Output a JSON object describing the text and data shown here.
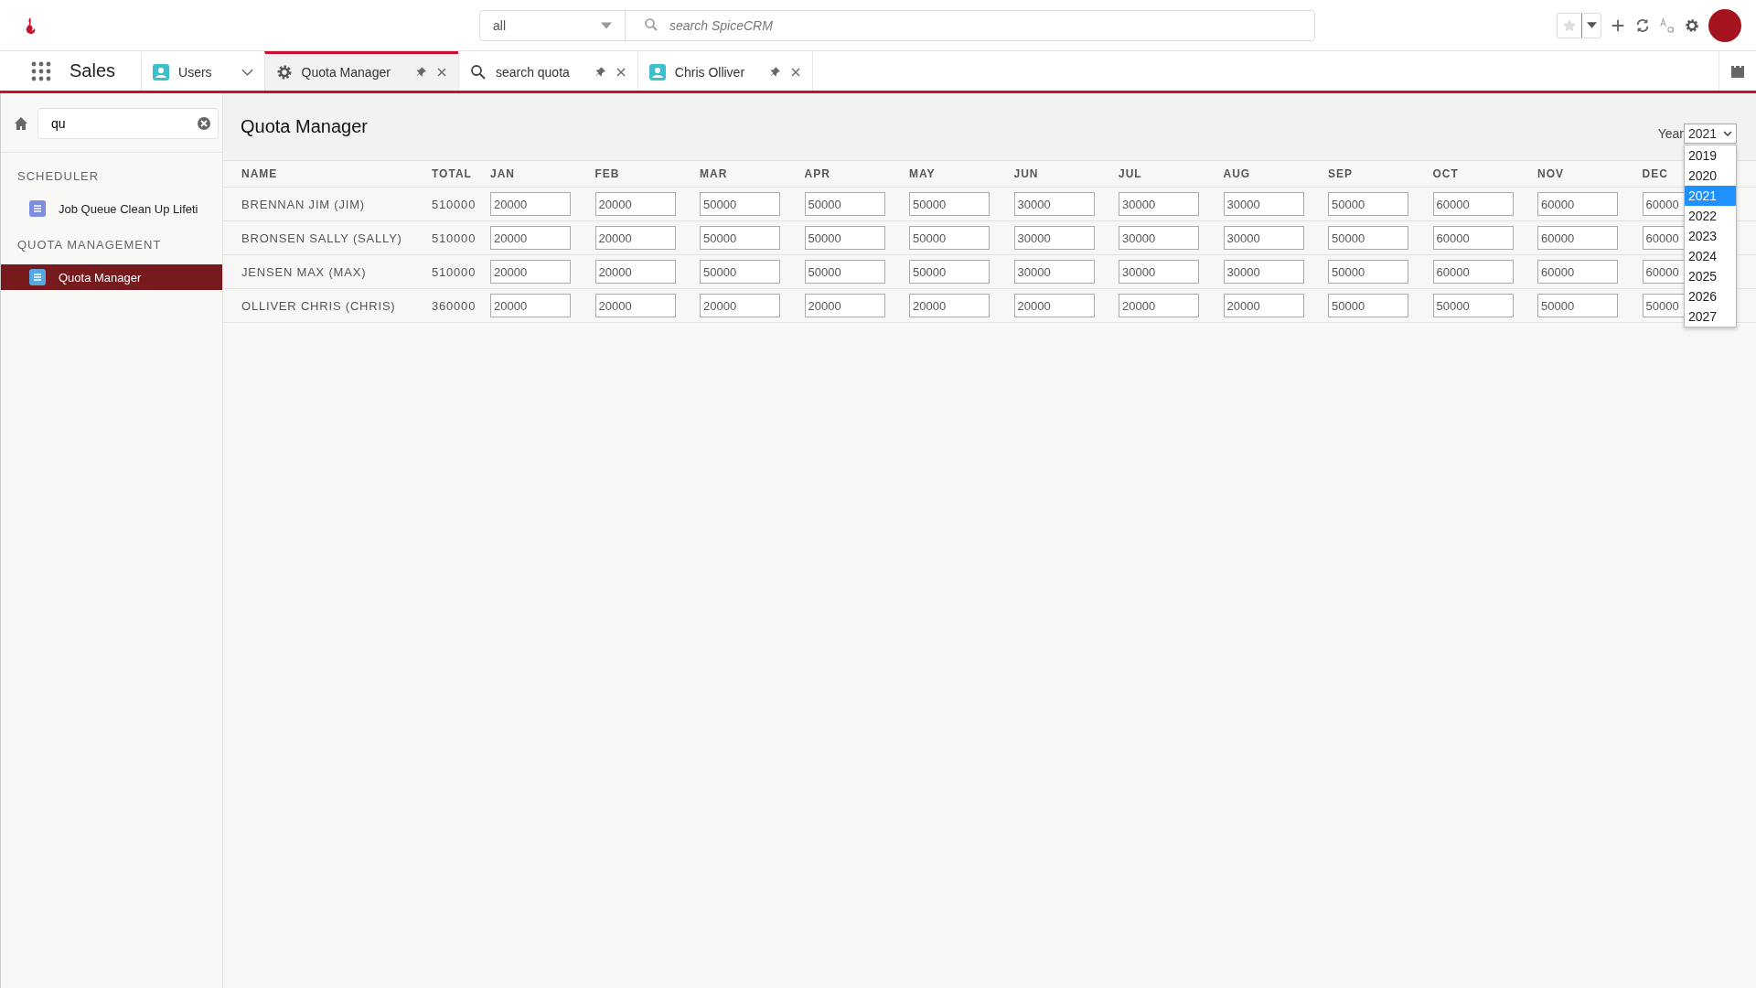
{
  "header": {
    "scope": "all",
    "search_placeholder": "search SpiceCRM"
  },
  "app_title": "Sales",
  "favorite": false,
  "tabs": [
    {
      "label": "Users",
      "kind": "module",
      "selected": false
    },
    {
      "label": "Quota Manager",
      "kind": "tool",
      "selected": true
    },
    {
      "label": "search quota",
      "kind": "search",
      "selected": false
    },
    {
      "label": "Chris Olliver",
      "kind": "record",
      "selected": false
    }
  ],
  "sidebar": {
    "search_value": "qu",
    "sections": [
      {
        "title": "SCHEDULER",
        "items": [
          {
            "label": "Job Queue Clean Up Lifeti",
            "color": "#7f8de1",
            "selected": false
          }
        ]
      },
      {
        "title": "QUOTA MANAGEMENT",
        "items": [
          {
            "label": "Quota Manager",
            "color": "#54a7e0",
            "selected": true
          }
        ]
      }
    ]
  },
  "page_title": "Quota Manager",
  "year": {
    "label": "Year",
    "value": "2021",
    "options": [
      {
        "label": "2019",
        "selected": false
      },
      {
        "label": "2020",
        "selected": false
      },
      {
        "label": "2021",
        "selected": true
      },
      {
        "label": "2022",
        "selected": false
      },
      {
        "label": "2023",
        "selected": false
      },
      {
        "label": "2024",
        "selected": false
      },
      {
        "label": "2025",
        "selected": false
      },
      {
        "label": "2026",
        "selected": false
      },
      {
        "label": "2027",
        "selected": false
      }
    ]
  },
  "table": {
    "columns": [
      "NAME",
      "TOTAL",
      "JAN",
      "FEB",
      "MAR",
      "APR",
      "MAY",
      "JUN",
      "JUL",
      "AUG",
      "SEP",
      "OCT",
      "NOV",
      "DEC"
    ],
    "rows": [
      {
        "name": "BRENNAN JIM (JIM)",
        "total": "510000",
        "months": [
          "20000",
          "20000",
          "50000",
          "50000",
          "50000",
          "30000",
          "30000",
          "30000",
          "50000",
          "60000",
          "60000",
          "60000"
        ]
      },
      {
        "name": "BRONSEN SALLY (SALLY)",
        "total": "510000",
        "months": [
          "20000",
          "20000",
          "50000",
          "50000",
          "50000",
          "30000",
          "30000",
          "30000",
          "50000",
          "60000",
          "60000",
          "60000"
        ]
      },
      {
        "name": "JENSEN MAX (MAX)",
        "total": "510000",
        "months": [
          "20000",
          "20000",
          "50000",
          "50000",
          "50000",
          "30000",
          "30000",
          "30000",
          "50000",
          "60000",
          "60000",
          "60000"
        ]
      },
      {
        "name": "OLLIVER CHRIS (CHRIS)",
        "total": "360000",
        "months": [
          "20000",
          "20000",
          "20000",
          "20000",
          "20000",
          "20000",
          "20000",
          "20000",
          "50000",
          "50000",
          "50000",
          "50000"
        ]
      }
    ]
  }
}
